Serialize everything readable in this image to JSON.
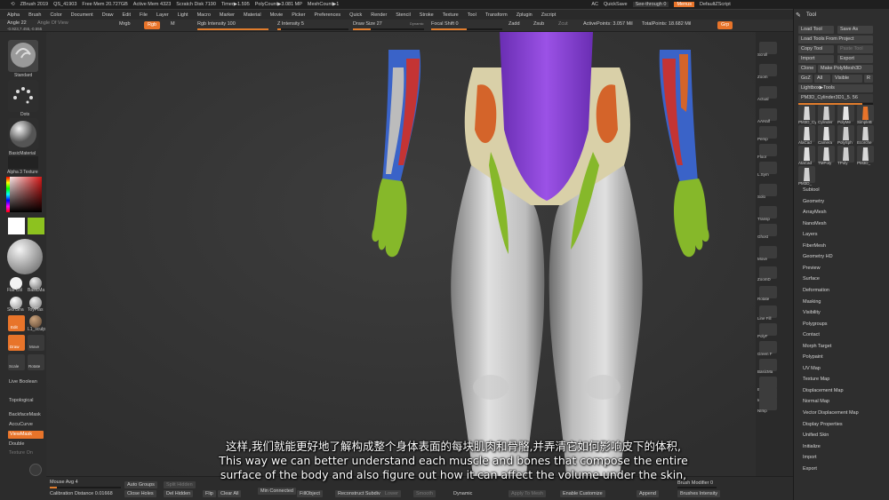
{
  "app": {
    "name": "ZBrush 2019",
    "qs": "QS_41903",
    "free_mem": "Free Mem 20.727GB",
    "active_mem": "Active Mem 4323",
    "scratch_disk": "Scratch Disk 7190",
    "timer": "Timer▶1.595",
    "poly_count": "PolyCount▶3.081 MP",
    "mesh_count": "MeshCount▶1",
    "ac": "AC",
    "quicksave": "QuickSave",
    "see_through": "See-through  0",
    "menus": "Menus",
    "script": "DefaultZScript"
  },
  "menu": [
    "Alpha",
    "Brush",
    "Color",
    "Document",
    "Draw",
    "Edit",
    "File",
    "Layer",
    "Light",
    "Macro",
    "Marker",
    "Material",
    "Movie",
    "Picker",
    "Preferences",
    "Quick",
    "Render",
    "Stencil",
    "Stroke",
    "Texture",
    "Tool",
    "Transform",
    "Zplugin",
    "Zscript"
  ],
  "shelf": {
    "angle": "Angle 22",
    "angle_of_view": "Angle Of View",
    "coords": "-0.923,7.455,-0.555",
    "mrgb": "Mrgb",
    "rgb": "Rgb",
    "m": "M",
    "rgb_intensity": "Rgb Intensity 100",
    "z_intensity": "Z Intensity 5",
    "draw_size": "Draw Size 27",
    "dynamic": "Dynamic",
    "focal_shift": "Focal Shift 0",
    "zadd": "Zadd",
    "zsub": "Zsub",
    "zcut": "Zcut",
    "active_points": "ActivePoints: 3.057 Mil",
    "total_points": "TotalPoints: 18.682 Mil",
    "zgrp": "Grp"
  },
  "left": {
    "standard": "Standard",
    "dots": "Dots",
    "basic_material": "BasicMaterial",
    "alpha": "Alpha 3 Texture",
    "brushes": [
      "Flat Col",
      "BasicMa",
      "SkinSha",
      "ToyPlas"
    ],
    "edit": "Edit",
    "draw": "Draw",
    "move": "Move",
    "scale": "Scale",
    "rotate": "Rotate",
    "l1": "L1_sculp",
    "live_boolean": "Live Boolean",
    "topological": "Topological",
    "backface": "BackfaceMask",
    "accucurve": "AccuCurve",
    "viewmask": "ViewMask",
    "double": "Double",
    "texture_on": "Texture On"
  },
  "right_shelf": [
    "Scroll",
    "Zoom",
    "Actual",
    "AAHalf",
    "Persp",
    "Floor",
    "L.Sym",
    "Solo",
    "Transp",
    "Ghost",
    "Move",
    "ZoomD",
    "Rotate",
    "Line Fill",
    "PolyF",
    "Green F",
    "BasicMa",
    "Exp.S",
    "Imp",
    "NImp"
  ],
  "tool_panel": {
    "title": "Tool",
    "load_tool": "Load Tool",
    "save_as": "Save As",
    "load_from_project": "Load Tools From Project",
    "copy_tool": "Copy Tool",
    "paste_tool": "Paste Tool",
    "import": "Import",
    "export": "Export",
    "clone": "Clone",
    "make_polymesh": "Make PolyMesh3D",
    "goz": "GoZ",
    "all": "All",
    "visible": "Visible",
    "r": "R",
    "lightbox": "Lightbox▶Tools",
    "current_tool": "PM3D_Cylinder3D1_5. 56",
    "thumbs": [
      "PM3D_Cylinder",
      "Cylinder",
      "PolyMe",
      "SimpleB",
      "AlaCad",
      "Camera",
      "PolySph",
      "Ecorche",
      "AtaCad",
      "TMPoly",
      "TPoly",
      "PM3D_",
      "PM3D_"
    ],
    "items": [
      "Subtool",
      "Geometry",
      "ArrayMesh",
      "NanoMesh",
      "Layers",
      "FiberMesh",
      "Geometry HD",
      "Preview",
      "Surface",
      "Deformation",
      "Masking",
      "Visibility",
      "Polygroups",
      "Contact",
      "Morph Target",
      "Polypaint",
      "UV Map",
      "Texture Map",
      "Displacement Map",
      "Normal Map",
      "Vector Displacement Map",
      "Display Properties",
      "Unified Skin",
      "Initialize",
      "Import",
      "Export"
    ]
  },
  "bottom": {
    "mouse_avg": "Mouse Avg 4",
    "calibration": "Calibration Distance 0.01668",
    "auto_groups": "Auto Groups",
    "split_hidden": "Split Hidden",
    "close_holes": "Close Holes",
    "del_hidden": "Del Hidden",
    "flip": "Flip",
    "clear_all": "Clear All",
    "min_connected": "Min Connected",
    "fill_object": "FillObject",
    "reconstruct": "Reconstruct Subdiv",
    "lower": "Lower",
    "smooth": "Smooth",
    "dynamic": "Dynamic",
    "apply_to_mesh": "Apply To Mesh",
    "enable_customize": "Enable Customize",
    "append": "Append",
    "brush_modifier": "Brush Modifier 0",
    "brushes_intensity": "Brushes Intensity"
  },
  "subtitles": {
    "zh": "这样,我们就能更好地了解构成整个身体表面的每块肌肉和骨骼,并弄清它如何影响皮下的体积,",
    "en1": "This way we can better understand each muscle and bones that compose the entire",
    "en2": "surface of the body and also figure out how it can affect the volume under the skin,"
  },
  "colors": {
    "accent": "#e8742a",
    "muscle_purple": "#8a3fd1",
    "muscle_orange": "#d4642a",
    "muscle_green": "#86b82a",
    "muscle_blue": "#3a63c8",
    "skin": "#d7d7d7"
  }
}
